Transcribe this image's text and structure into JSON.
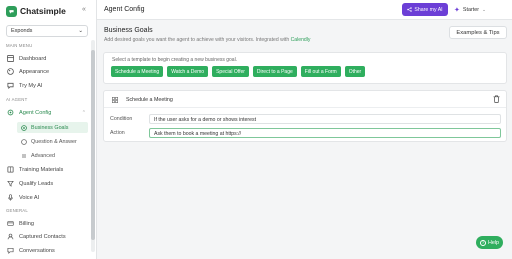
{
  "brand": {
    "name": "Chatsimple",
    "color": "#2e9e5a"
  },
  "sidebar": {
    "collapse_icon": "«",
    "workspace": {
      "value": "Exponds",
      "chevron": "⌄"
    },
    "main_menu_label": "MAIN MENU",
    "main_items": [
      {
        "label": "Dashboard",
        "icon": "dashboard-icon"
      },
      {
        "label": "Appearance",
        "icon": "palette-icon"
      },
      {
        "label": "Try My AI",
        "icon": "chat-icon"
      }
    ],
    "ai_agent_label": "AI AGENT",
    "agent_config": {
      "label": "Agent Config",
      "chevron": "⌃"
    },
    "agent_sub_items": [
      {
        "label": "Business Goals",
        "active": true
      },
      {
        "label": "Question & Answer",
        "active": false
      },
      {
        "label": "Advanced",
        "active": false
      }
    ],
    "agent_items": [
      {
        "label": "Training Materials",
        "icon": "book-icon"
      },
      {
        "label": "Qualify Leads",
        "icon": "filter-icon"
      },
      {
        "label": "Voice AI",
        "icon": "mic-icon"
      }
    ],
    "general_label": "GENERAL",
    "general_items": [
      {
        "label": "Billing",
        "icon": "billing-icon"
      },
      {
        "label": "Captured Contacts",
        "icon": "contacts-icon"
      },
      {
        "label": "Conversations",
        "icon": "conversation-icon"
      }
    ]
  },
  "topbar": {
    "title": "Agent Config",
    "share_label": "Share my AI",
    "plan_label": "Starter",
    "plan_chevron": "⌄"
  },
  "header": {
    "title": "Business Goals",
    "subtitle_prefix": "Add desired goals you want the agent to achieve with your visitors. Integrated with ",
    "subtitle_link": "Calendly",
    "tips_label": "Examples & Tips"
  },
  "templates": {
    "hint": "Select a template to begin creating a new business goal.",
    "buttons": [
      "Schedule a Meeting",
      "Watch a Demo",
      "Special Offer",
      "Direct to a Page",
      "Fill out a Form",
      "Other"
    ]
  },
  "goal": {
    "title": "Schedule a Meeting",
    "condition_label": "Condition",
    "condition_value": "If the user asks for a demo or shows interest",
    "action_label": "Action",
    "action_value": "Ask them to book a meeting at https://"
  },
  "help": {
    "label": "Help",
    "icon_glyph": "?"
  },
  "colors": {
    "accent_purple": "#6c3fd6",
    "accent_green": "#2fae5e"
  }
}
